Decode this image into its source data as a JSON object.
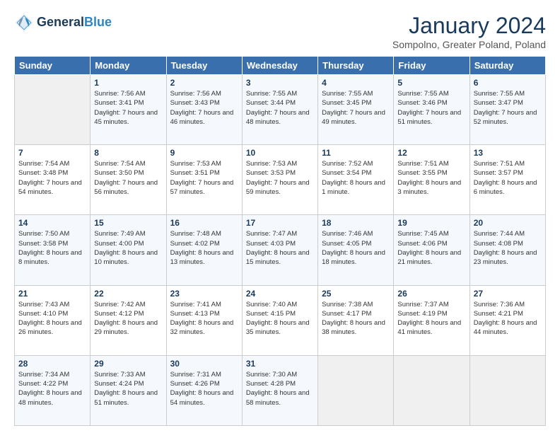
{
  "header": {
    "logo_line1": "General",
    "logo_line2": "Blue",
    "title": "January 2024",
    "subtitle": "Sompolno, Greater Poland, Poland"
  },
  "days_of_week": [
    "Sunday",
    "Monday",
    "Tuesday",
    "Wednesday",
    "Thursday",
    "Friday",
    "Saturday"
  ],
  "weeks": [
    [
      {
        "day": "",
        "sunrise": "",
        "sunset": "",
        "daylight": ""
      },
      {
        "day": "1",
        "sunrise": "Sunrise: 7:56 AM",
        "sunset": "Sunset: 3:41 PM",
        "daylight": "Daylight: 7 hours and 45 minutes."
      },
      {
        "day": "2",
        "sunrise": "Sunrise: 7:56 AM",
        "sunset": "Sunset: 3:43 PM",
        "daylight": "Daylight: 7 hours and 46 minutes."
      },
      {
        "day": "3",
        "sunrise": "Sunrise: 7:55 AM",
        "sunset": "Sunset: 3:44 PM",
        "daylight": "Daylight: 7 hours and 48 minutes."
      },
      {
        "day": "4",
        "sunrise": "Sunrise: 7:55 AM",
        "sunset": "Sunset: 3:45 PM",
        "daylight": "Daylight: 7 hours and 49 minutes."
      },
      {
        "day": "5",
        "sunrise": "Sunrise: 7:55 AM",
        "sunset": "Sunset: 3:46 PM",
        "daylight": "Daylight: 7 hours and 51 minutes."
      },
      {
        "day": "6",
        "sunrise": "Sunrise: 7:55 AM",
        "sunset": "Sunset: 3:47 PM",
        "daylight": "Daylight: 7 hours and 52 minutes."
      }
    ],
    [
      {
        "day": "7",
        "sunrise": "Sunrise: 7:54 AM",
        "sunset": "Sunset: 3:48 PM",
        "daylight": "Daylight: 7 hours and 54 minutes."
      },
      {
        "day": "8",
        "sunrise": "Sunrise: 7:54 AM",
        "sunset": "Sunset: 3:50 PM",
        "daylight": "Daylight: 7 hours and 56 minutes."
      },
      {
        "day": "9",
        "sunrise": "Sunrise: 7:53 AM",
        "sunset": "Sunset: 3:51 PM",
        "daylight": "Daylight: 7 hours and 57 minutes."
      },
      {
        "day": "10",
        "sunrise": "Sunrise: 7:53 AM",
        "sunset": "Sunset: 3:53 PM",
        "daylight": "Daylight: 7 hours and 59 minutes."
      },
      {
        "day": "11",
        "sunrise": "Sunrise: 7:52 AM",
        "sunset": "Sunset: 3:54 PM",
        "daylight": "Daylight: 8 hours and 1 minute."
      },
      {
        "day": "12",
        "sunrise": "Sunrise: 7:51 AM",
        "sunset": "Sunset: 3:55 PM",
        "daylight": "Daylight: 8 hours and 3 minutes."
      },
      {
        "day": "13",
        "sunrise": "Sunrise: 7:51 AM",
        "sunset": "Sunset: 3:57 PM",
        "daylight": "Daylight: 8 hours and 6 minutes."
      }
    ],
    [
      {
        "day": "14",
        "sunrise": "Sunrise: 7:50 AM",
        "sunset": "Sunset: 3:58 PM",
        "daylight": "Daylight: 8 hours and 8 minutes."
      },
      {
        "day": "15",
        "sunrise": "Sunrise: 7:49 AM",
        "sunset": "Sunset: 4:00 PM",
        "daylight": "Daylight: 8 hours and 10 minutes."
      },
      {
        "day": "16",
        "sunrise": "Sunrise: 7:48 AM",
        "sunset": "Sunset: 4:02 PM",
        "daylight": "Daylight: 8 hours and 13 minutes."
      },
      {
        "day": "17",
        "sunrise": "Sunrise: 7:47 AM",
        "sunset": "Sunset: 4:03 PM",
        "daylight": "Daylight: 8 hours and 15 minutes."
      },
      {
        "day": "18",
        "sunrise": "Sunrise: 7:46 AM",
        "sunset": "Sunset: 4:05 PM",
        "daylight": "Daylight: 8 hours and 18 minutes."
      },
      {
        "day": "19",
        "sunrise": "Sunrise: 7:45 AM",
        "sunset": "Sunset: 4:06 PM",
        "daylight": "Daylight: 8 hours and 21 minutes."
      },
      {
        "day": "20",
        "sunrise": "Sunrise: 7:44 AM",
        "sunset": "Sunset: 4:08 PM",
        "daylight": "Daylight: 8 hours and 23 minutes."
      }
    ],
    [
      {
        "day": "21",
        "sunrise": "Sunrise: 7:43 AM",
        "sunset": "Sunset: 4:10 PM",
        "daylight": "Daylight: 8 hours and 26 minutes."
      },
      {
        "day": "22",
        "sunrise": "Sunrise: 7:42 AM",
        "sunset": "Sunset: 4:12 PM",
        "daylight": "Daylight: 8 hours and 29 minutes."
      },
      {
        "day": "23",
        "sunrise": "Sunrise: 7:41 AM",
        "sunset": "Sunset: 4:13 PM",
        "daylight": "Daylight: 8 hours and 32 minutes."
      },
      {
        "day": "24",
        "sunrise": "Sunrise: 7:40 AM",
        "sunset": "Sunset: 4:15 PM",
        "daylight": "Daylight: 8 hours and 35 minutes."
      },
      {
        "day": "25",
        "sunrise": "Sunrise: 7:38 AM",
        "sunset": "Sunset: 4:17 PM",
        "daylight": "Daylight: 8 hours and 38 minutes."
      },
      {
        "day": "26",
        "sunrise": "Sunrise: 7:37 AM",
        "sunset": "Sunset: 4:19 PM",
        "daylight": "Daylight: 8 hours and 41 minutes."
      },
      {
        "day": "27",
        "sunrise": "Sunrise: 7:36 AM",
        "sunset": "Sunset: 4:21 PM",
        "daylight": "Daylight: 8 hours and 44 minutes."
      }
    ],
    [
      {
        "day": "28",
        "sunrise": "Sunrise: 7:34 AM",
        "sunset": "Sunset: 4:22 PM",
        "daylight": "Daylight: 8 hours and 48 minutes."
      },
      {
        "day": "29",
        "sunrise": "Sunrise: 7:33 AM",
        "sunset": "Sunset: 4:24 PM",
        "daylight": "Daylight: 8 hours and 51 minutes."
      },
      {
        "day": "30",
        "sunrise": "Sunrise: 7:31 AM",
        "sunset": "Sunset: 4:26 PM",
        "daylight": "Daylight: 8 hours and 54 minutes."
      },
      {
        "day": "31",
        "sunrise": "Sunrise: 7:30 AM",
        "sunset": "Sunset: 4:28 PM",
        "daylight": "Daylight: 8 hours and 58 minutes."
      },
      {
        "day": "",
        "sunrise": "",
        "sunset": "",
        "daylight": ""
      },
      {
        "day": "",
        "sunrise": "",
        "sunset": "",
        "daylight": ""
      },
      {
        "day": "",
        "sunrise": "",
        "sunset": "",
        "daylight": ""
      }
    ]
  ]
}
